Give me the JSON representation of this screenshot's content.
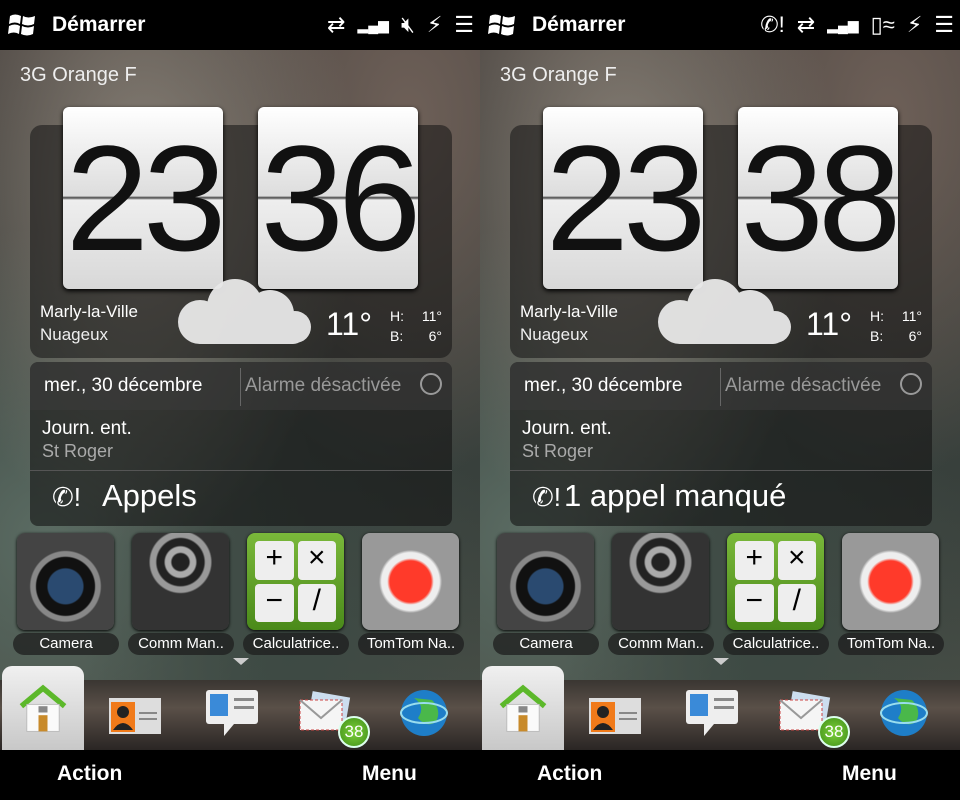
{
  "screens": [
    {
      "status": {
        "start_label": "Démarrer",
        "icons": [
          "data-sync-icon",
          "signal-icon",
          "speaker-muted-icon",
          "charging-icon",
          "menu-dropdown-icon"
        ]
      },
      "operator": "3G Orange F",
      "clock": {
        "hour": "23",
        "minute": "36"
      },
      "weather": {
        "city": "Marly-la-Ville",
        "condition": "Nuageux",
        "temp": "11°",
        "high_label": "H:",
        "high": "11°",
        "low_label": "B:",
        "low": "6°"
      },
      "date": "mer., 30 décembre",
      "alarm": "Alarme désactivée",
      "event": {
        "title": "Journ. ent.",
        "subtitle": "St Roger"
      },
      "calls": "Appels",
      "apps": [
        "Camera",
        "Comm Man..",
        "Calculatrice..",
        "TomTom Na.."
      ],
      "mail_count": "38",
      "softkeys": {
        "left": "Action",
        "right": "Menu"
      }
    },
    {
      "status": {
        "start_label": "Démarrer",
        "icons": [
          "missed-call-icon",
          "data-sync-icon",
          "signal-icon",
          "vibrate-icon",
          "charging-icon",
          "menu-dropdown-icon"
        ]
      },
      "operator": "3G Orange F",
      "clock": {
        "hour": "23",
        "minute": "38"
      },
      "weather": {
        "city": "Marly-la-Ville",
        "condition": "Nuageux",
        "temp": "11°",
        "high_label": "H:",
        "high": "11°",
        "low_label": "B:",
        "low": "6°"
      },
      "date": "mer., 30 décembre",
      "alarm": "Alarme désactivée",
      "event": {
        "title": "Journ. ent.",
        "subtitle": "St Roger"
      },
      "calls": "1 appel manqué",
      "apps": [
        "Camera",
        "Comm Man..",
        "Calculatrice..",
        "TomTom Na.."
      ],
      "mail_count": "38",
      "softkeys": {
        "left": "Action",
        "right": "Menu"
      }
    }
  ]
}
